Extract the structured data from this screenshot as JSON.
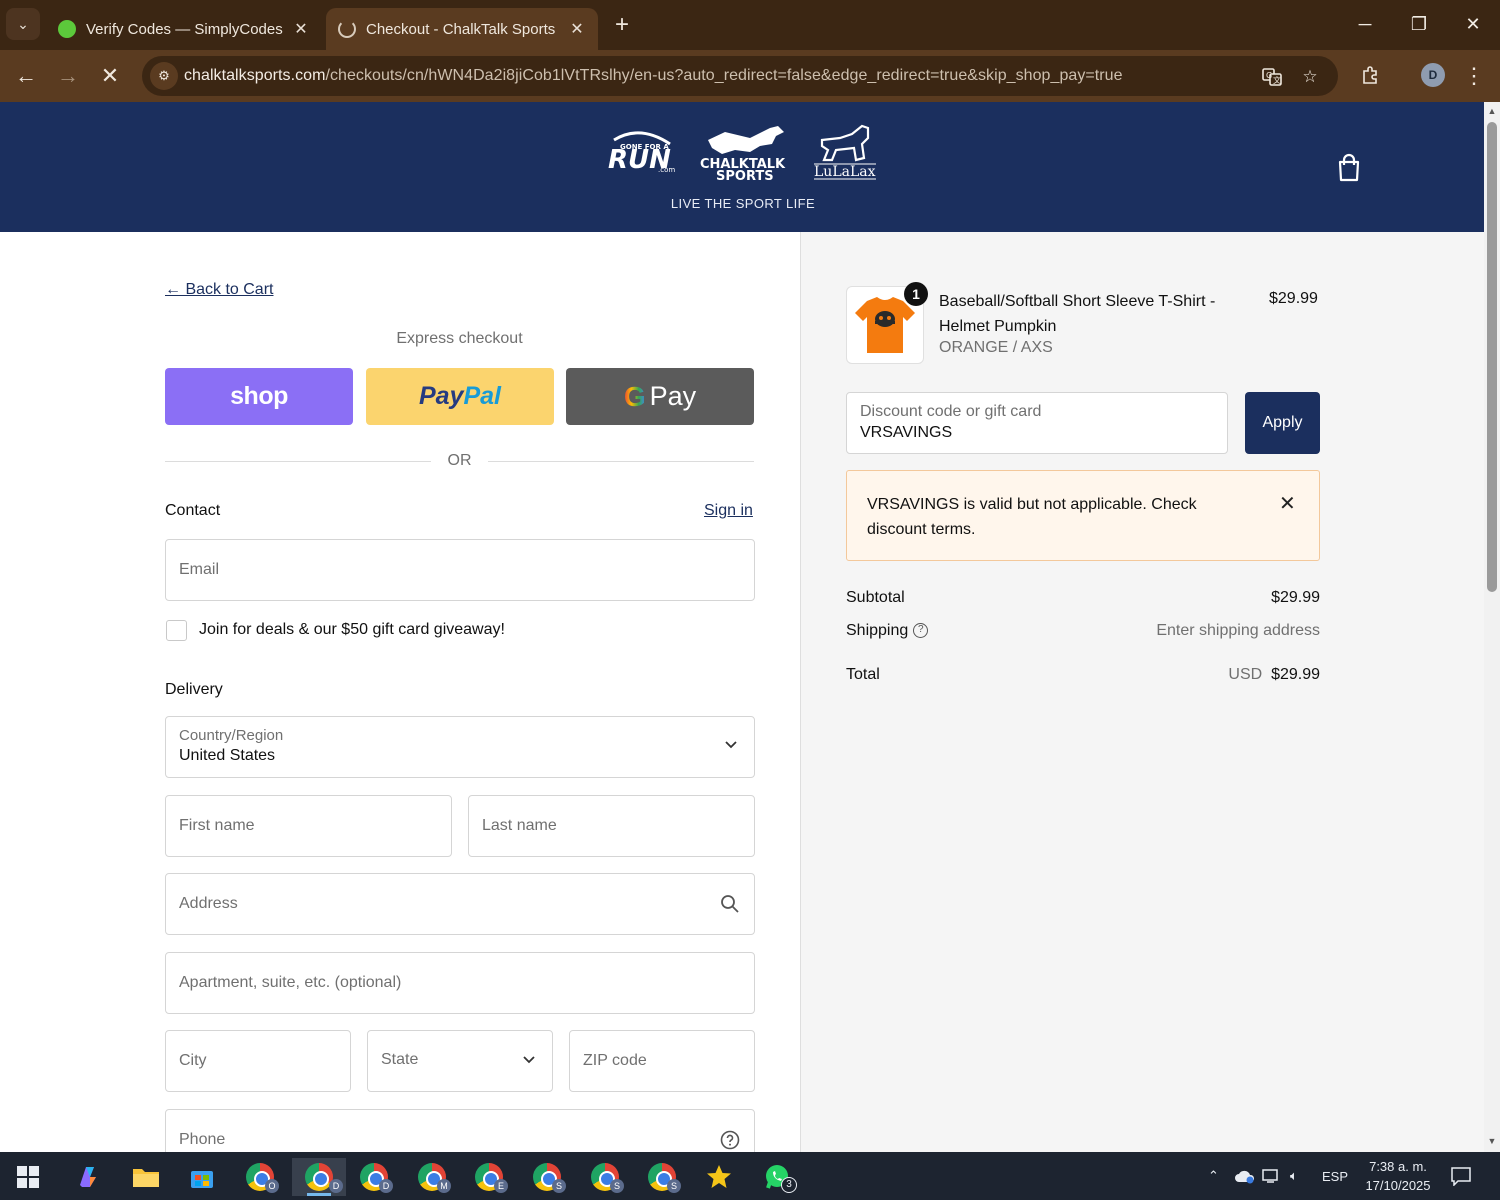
{
  "browser": {
    "tabs": [
      {
        "title": "Verify Codes — SimplyCodes",
        "active": false
      },
      {
        "title": "Checkout - ChalkTalk Sports",
        "active": true
      }
    ],
    "url_host": "chalktalksports.com",
    "url_path": "/checkouts/cn/hWN4Da2i8jiCob1lVtTRslhy/en-us?auto_redirect=false&edge_redirect=true&skip_shop_pay=true",
    "profile_initial": "D"
  },
  "header": {
    "logo_run_small": "GONE FOR A",
    "logo_run": "RUN",
    "logo_run_suffix": ".com",
    "logo_chalktalk_1": "CHALKTALK",
    "logo_chalktalk_2": "SPORTS",
    "logo_lulalax": "LuLaLax",
    "tagline": "LIVE THE SPORT LIFE"
  },
  "checkout": {
    "back_link": "← Back to Cart",
    "express_title": "Express checkout",
    "shop_label": "shop",
    "paypal_label_1": "Pay",
    "paypal_label_2": "Pal",
    "gpay_g": "G",
    "gpay_label": "Pay",
    "or_label": "OR",
    "contact": {
      "title": "Contact",
      "sign_in": "Sign in",
      "email_placeholder": "Email",
      "newsletter_label": "Join for deals & our $50 gift card giveaway!"
    },
    "delivery": {
      "title": "Delivery",
      "country_label": "Country/Region",
      "country_value": "United States",
      "first_name": "First name",
      "last_name": "Last name",
      "address": "Address",
      "apartment": "Apartment, suite, etc. (optional)",
      "city": "City",
      "state": "State",
      "zip": "ZIP code",
      "phone": "Phone"
    }
  },
  "summary": {
    "item": {
      "quantity": "1",
      "name": "Baseball/Softball Short Sleeve T-Shirt - Helmet Pumpkin",
      "variant": "ORANGE / AXS",
      "price": "$29.99"
    },
    "discount_label": "Discount code or gift card",
    "discount_value": "VRSAVINGS",
    "apply_label": "Apply",
    "alert_text": "VRSAVINGS is valid but not applicable. Check discount terms.",
    "subtotal_label": "Subtotal",
    "subtotal_value": "$29.99",
    "shipping_label": "Shipping",
    "shipping_value": "Enter shipping address",
    "total_label": "Total",
    "total_currency": "USD",
    "total_value": "$29.99"
  },
  "taskbar": {
    "language": "ESP",
    "time": "7:38 a. m.",
    "date": "17/10/2025",
    "whatsapp_badge": "3",
    "chrome_profiles": [
      "O",
      "D",
      "D",
      "M",
      "E",
      "S",
      "S",
      "S"
    ]
  },
  "colors": {
    "chrome_dark": "#3b2613",
    "chrome_toolbar": "#5a3b20",
    "brand_navy": "#1b2f5e",
    "shop_purple": "#8b6ff5",
    "paypal_yellow": "#fbd46e",
    "gpay_gray": "#5b5b5b",
    "alert_bg": "#fff6ec"
  }
}
